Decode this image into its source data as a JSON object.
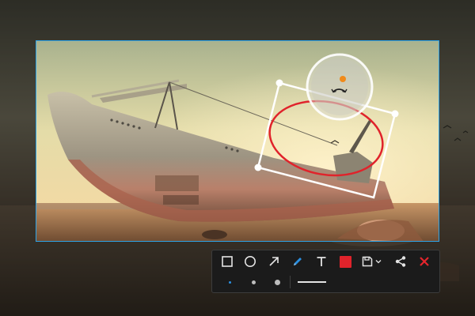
{
  "colors": {
    "selection_border": "#2ea3e6",
    "annotation_red": "#e0232b",
    "toolbar_bg": "#1b1b1b",
    "tool_icon": "#e4e4e4",
    "active_tool": "#2b8fe0",
    "close_red": "#e5252c"
  },
  "toolbar": {
    "tools": [
      {
        "name": "rectangle-icon",
        "selected": false
      },
      {
        "name": "ellipse-icon",
        "selected": false
      },
      {
        "name": "arrow-icon",
        "selected": false
      },
      {
        "name": "pencil-icon",
        "selected": true
      },
      {
        "name": "text-icon",
        "selected": false
      },
      {
        "name": "color-swatch",
        "color": "#e0232b"
      },
      {
        "name": "save-icon",
        "has_dropdown": true
      },
      {
        "name": "share-icon"
      },
      {
        "name": "close-icon"
      }
    ],
    "brush_sizes": [
      "small",
      "medium",
      "large"
    ],
    "selected_brush_size": "small"
  },
  "annotations": {
    "ellipse_color": "#e0232b",
    "rectangle_outline": "white",
    "rotate_handle_icon": "rotate-icon"
  }
}
